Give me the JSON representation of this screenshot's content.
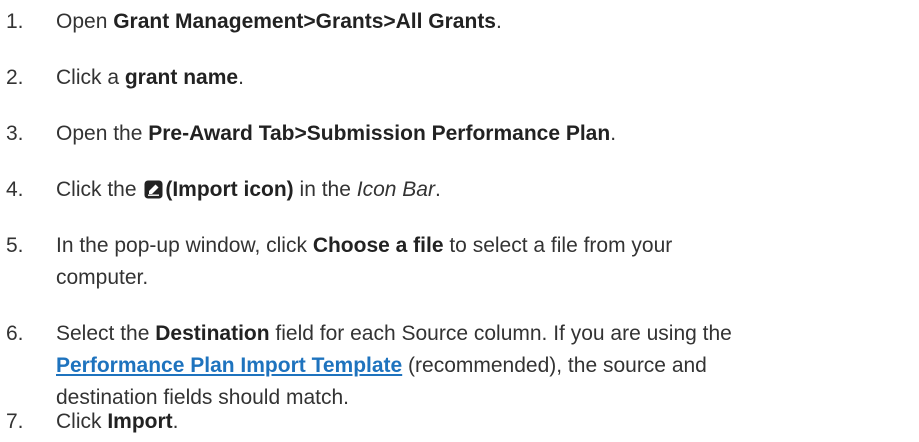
{
  "steps": [
    {
      "number": "1.",
      "pre": "Open ",
      "bold": "Grant Management>Grants>All Grants",
      "post": "."
    },
    {
      "number": "2.",
      "pre": "Click a ",
      "bold": "grant name",
      "post": "."
    },
    {
      "number": "3.",
      "pre": "Open the ",
      "bold": "Pre-Award Tab>Submission Performance Plan",
      "post": "."
    },
    {
      "number": "4.",
      "pre": "Click the ",
      "icon": "import-icon",
      "bold": "(Import icon)",
      "mid": " in the ",
      "italic": "Icon Bar",
      "post": "."
    },
    {
      "number": "5.",
      "pre": "In the pop-up window, click ",
      "bold": "Choose a file",
      "post": " to select a file from your",
      "line2": "computer."
    },
    {
      "number": "6.",
      "pre": "Select the ",
      "bold": "Destination",
      "post": " field for each Source column. If you are using the",
      "link": "Performance Plan Import Template",
      "post2": " (recommended), the source and",
      "line3": "destination fields should match."
    },
    {
      "number": "7.",
      "pre": "Click ",
      "bold": "Import",
      "post": "."
    }
  ],
  "colors": {
    "text": "#333333",
    "link": "#1e73be",
    "icon": "#222222"
  }
}
